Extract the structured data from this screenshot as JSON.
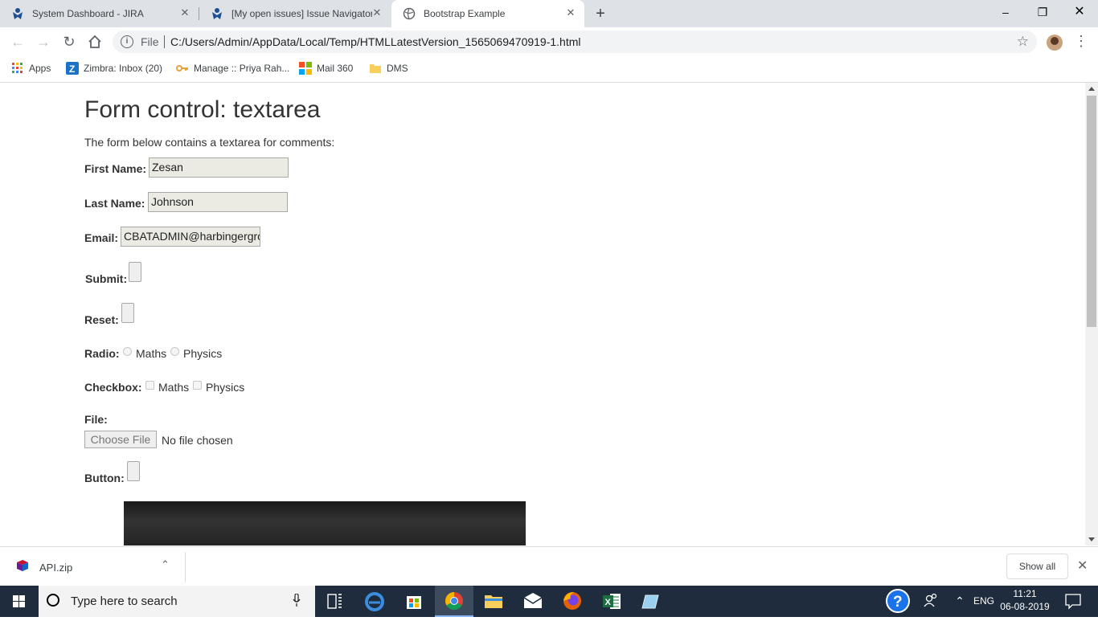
{
  "browser": {
    "tabs": [
      {
        "title": "System Dashboard - JIRA",
        "active": false
      },
      {
        "title": "[My open issues] Issue Navigator",
        "active": false
      },
      {
        "title": "Bootstrap Example",
        "active": true
      }
    ],
    "address": {
      "scheme_label": "File",
      "url": "C:/Users/Admin/AppData/Local/Temp/HTMLLatestVersion_1565069470919-1.html"
    },
    "bookmarks": [
      {
        "label": "Apps",
        "icon": "apps-grid-icon"
      },
      {
        "label": "Zimbra: Inbox (20)",
        "icon": "zimbra-icon"
      },
      {
        "label": "Manage :: Priya Rah...",
        "icon": "key-icon"
      },
      {
        "label": "Mail 360",
        "icon": "mail360-icon"
      },
      {
        "label": "DMS",
        "icon": "folder-icon"
      }
    ]
  },
  "page": {
    "heading": "Form control: textarea",
    "intro": "The form below contains a textarea for comments:",
    "first_name": {
      "label": "First Name:",
      "value": "Zesan"
    },
    "last_name": {
      "label": "Last Name:",
      "value": "Johnson"
    },
    "email": {
      "label": "Email:",
      "value": "CBATADMIN@harbingergro"
    },
    "submit": {
      "label": "Submit:"
    },
    "reset": {
      "label": "Reset:"
    },
    "radio": {
      "label": "Radio:",
      "options": [
        "Maths",
        "Physics"
      ]
    },
    "checkbox": {
      "label": "Checkbox:",
      "options": [
        "Maths",
        "Physics"
      ]
    },
    "file": {
      "label": "File:",
      "button": "Choose File",
      "status": "No file chosen"
    },
    "button": {
      "label": "Button:"
    }
  },
  "downloads": {
    "file": "API.zip",
    "show_all": "Show all"
  },
  "taskbar": {
    "search_placeholder": "Type here to search",
    "language": "ENG",
    "time": "11:21",
    "date": "06-08-2019"
  },
  "colors": {
    "tabstrip": "#dee1e6",
    "taskbar": "#1f2c3d",
    "input_bg": "#ebebe4"
  }
}
